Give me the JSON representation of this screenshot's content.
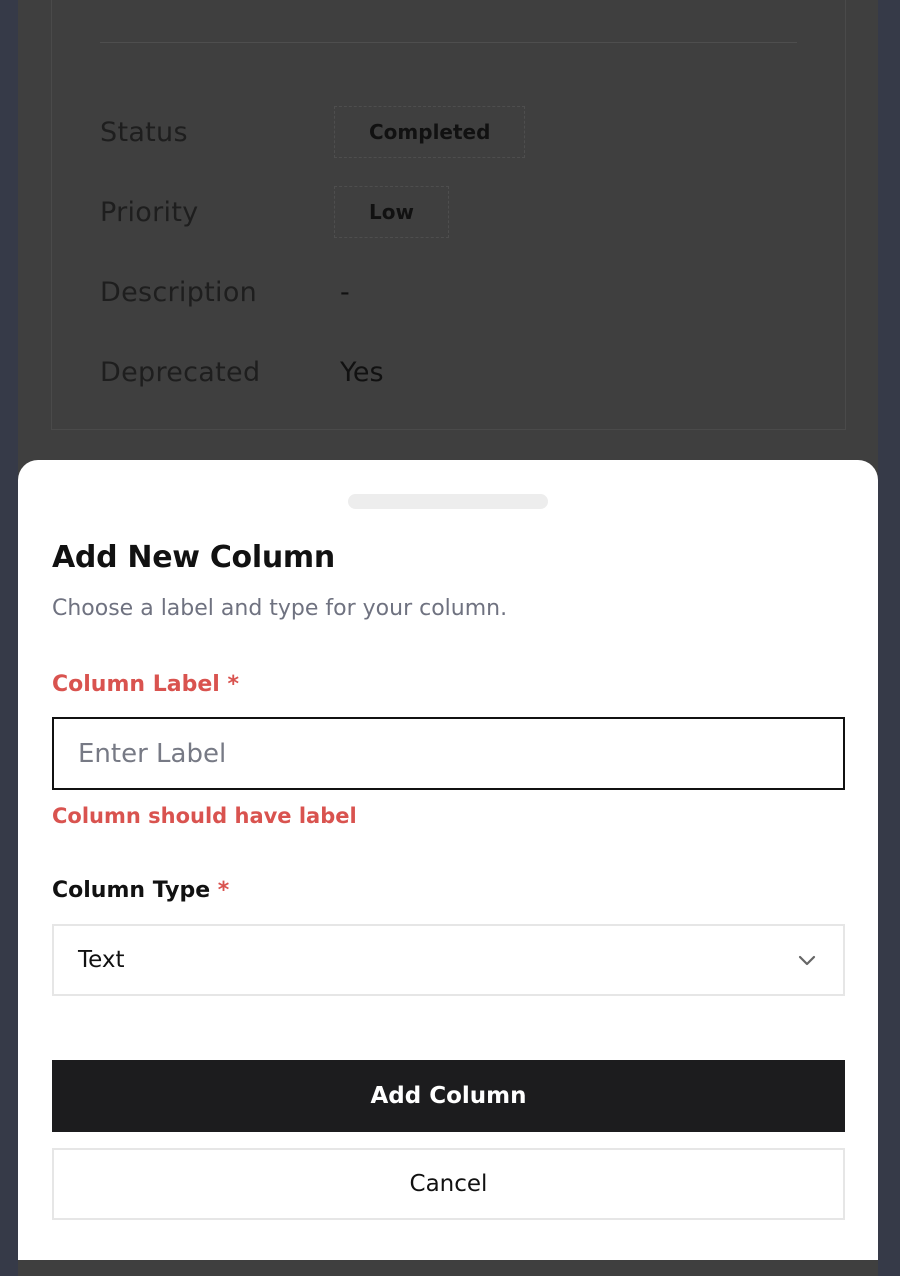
{
  "background": {
    "rows": [
      {
        "label": "Status",
        "value": "Completed",
        "kind": "badge"
      },
      {
        "label": "Priority",
        "value": "Low",
        "kind": "badge"
      },
      {
        "label": "Description",
        "value": "-",
        "kind": "text"
      },
      {
        "label": "Deprecated",
        "value": "Yes",
        "kind": "text"
      }
    ]
  },
  "sheet": {
    "title": "Add New Column",
    "subtitle": "Choose a label and type for your column.",
    "label_field": {
      "label": "Column Label",
      "required_mark": "*",
      "value": "",
      "placeholder": "Enter Label",
      "error": "Column should have label"
    },
    "type_field": {
      "label": "Column Type",
      "required_mark": "*",
      "selected": "Text"
    },
    "submit_label": "Add Column",
    "cancel_label": "Cancel"
  },
  "colors": {
    "overlay": "#363a48",
    "primary_button": "#1c1c1e",
    "error": "#d9534f"
  },
  "icons": {
    "select_chevron": "chevron-down-icon"
  }
}
